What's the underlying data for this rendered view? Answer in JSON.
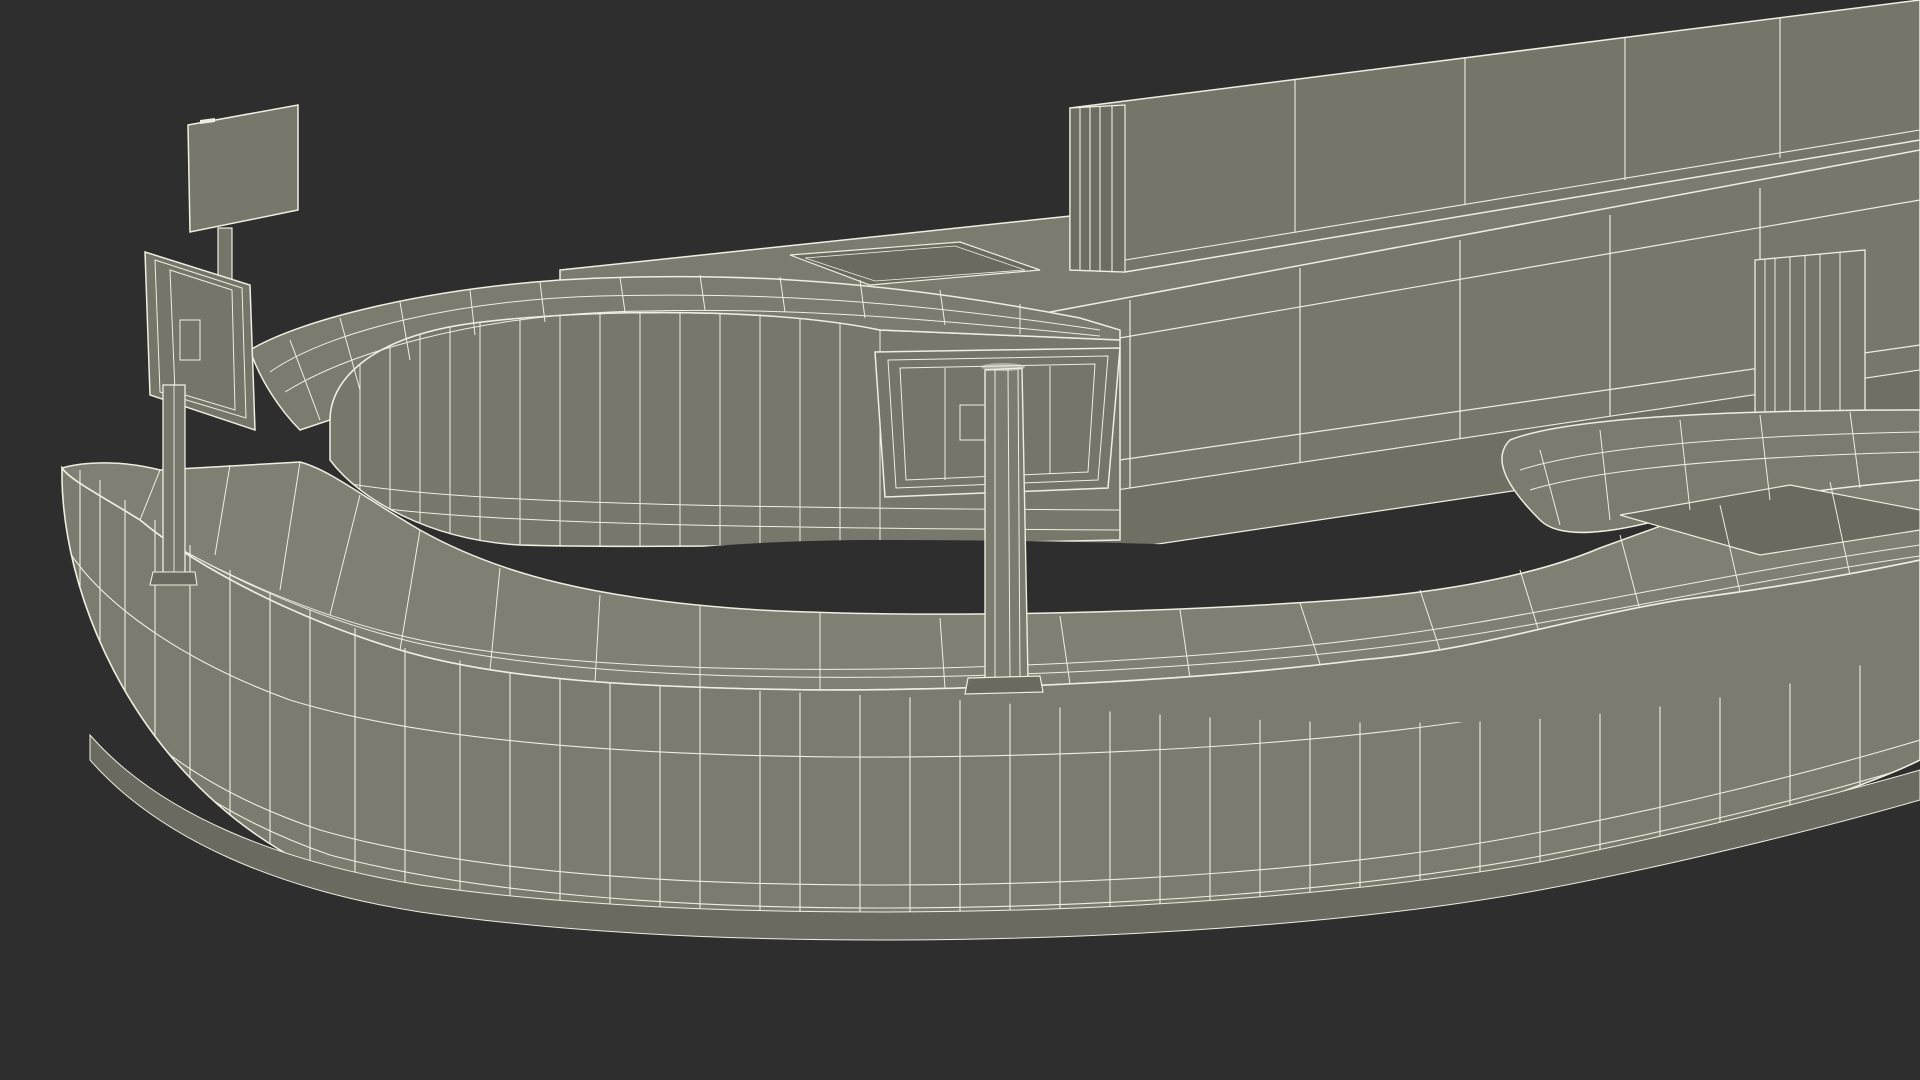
{
  "scene": {
    "subject": "wireframe-render",
    "background_color": "#2e2e2e",
    "surface_color": "#7b7b6f",
    "wire_color": "#efeee0",
    "shadow_color": "#5f5f55"
  }
}
